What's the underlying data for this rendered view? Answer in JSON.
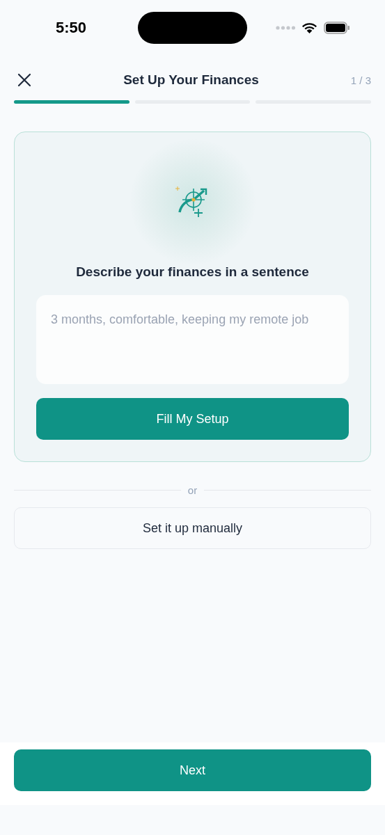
{
  "status_bar": {
    "time": "5:50"
  },
  "header": {
    "title": "Set Up Your Finances",
    "step": "1 / 3"
  },
  "progress_segments": [
    {
      "done": true
    },
    {
      "done": false
    },
    {
      "done": false
    }
  ],
  "card": {
    "prompt": "Describe your finances in a sentence",
    "input": {
      "placeholder": "3 months, comfortable, keeping my remote job"
    },
    "button": "Fill My Setup"
  },
  "divider_text": "or",
  "manual_button": "Set it up manually",
  "next_button": "Next"
}
